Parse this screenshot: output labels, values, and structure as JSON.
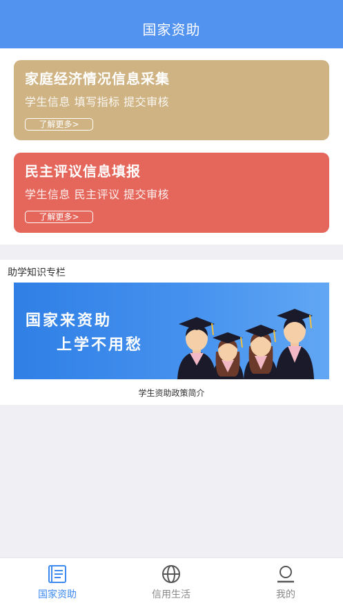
{
  "header": {
    "title": "国家资助"
  },
  "cards": [
    {
      "title": "家庭经济情况信息采集",
      "subtitle": "学生信息 填写指标 提交审核",
      "more_label": "了解更多>",
      "color": "#cfb383"
    },
    {
      "title": "民主评议信息填报",
      "subtitle": "学生信息 民主评议 提交审核",
      "more_label": "了解更多>",
      "color": "#e5675c"
    }
  ],
  "knowledge": {
    "title": "助学知识专栏",
    "banner": {
      "line1": "国家来资助",
      "line2": "上学不用愁"
    },
    "caption": "学生资助政策简介"
  },
  "tabbar": {
    "items": [
      {
        "label": "国家资助",
        "icon": "document-icon",
        "active": true
      },
      {
        "label": "信用生活",
        "icon": "globe-icon",
        "active": false
      },
      {
        "label": "我的",
        "icon": "user-icon",
        "active": false
      }
    ],
    "active_color": "#3c89f0"
  }
}
